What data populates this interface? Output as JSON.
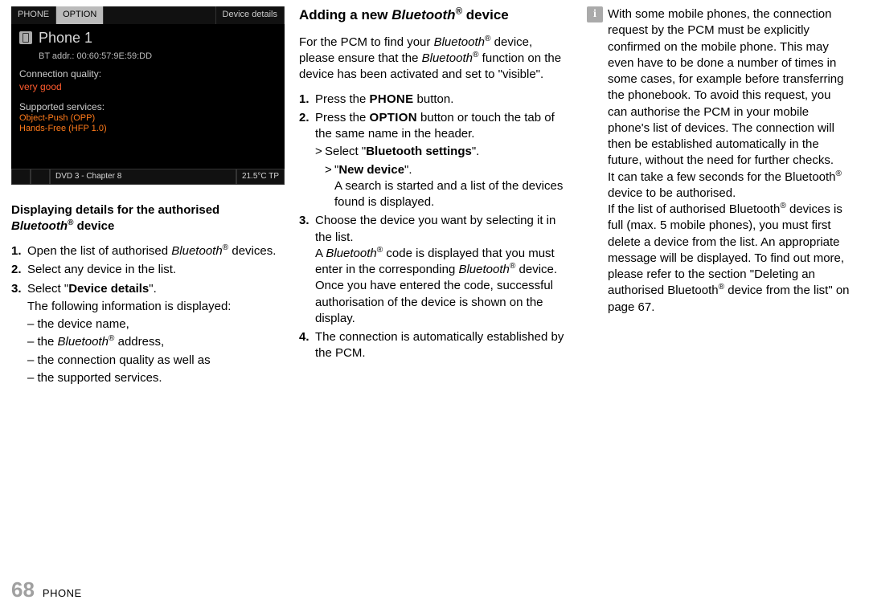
{
  "pcm": {
    "tabs": [
      "PHONE",
      "OPTION",
      "Device details"
    ],
    "phone_title": "Phone 1",
    "bt_addr_label": "BT addr.: 00:60:57:9E:59:DD",
    "quality_label": "Connection quality:",
    "quality_value": "very good",
    "services_label": "Supported services:",
    "services_value_1": "Object-Push (OPP)",
    "services_value_2": "Hands-Free (HFP 1.0)",
    "footer_media": "DVD 3 - Chapter 8",
    "footer_temp": "21.5°C  TP"
  },
  "col1": {
    "heading_pre": "Displaying details for the authorised ",
    "heading_bt": "Bluetooth",
    "heading_post": " device",
    "step1_a": "Open the list of authorised ",
    "step1_b": " devices.",
    "step2": "Select any device in the list.",
    "step3_a": "Select \"",
    "step3_link": "Device details",
    "step3_b": "\".",
    "step3_follow": "The following information is displayed:",
    "step3_d1": "– the device name,",
    "step3_d2_a": "– the ",
    "step3_d2_b": " address,",
    "step3_d3": "– the connection quality as well as",
    "step3_d4": "– the supported services."
  },
  "col2": {
    "heading_a": "Adding a new ",
    "heading_bt": "Bluetooth",
    "heading_b": " device",
    "intro_a": "For the PCM to find your ",
    "intro_b": " device, please ensure that the ",
    "intro_c": " function on the device has been activated and set to \"visible\".",
    "s1_a": "Press the ",
    "s1_btn": "PHONE",
    "s1_b": " button.",
    "s2_a": "Press the ",
    "s2_btn": "OPTION",
    "s2_b": " button or touch the tab of the same name in the header.",
    "s2_sub1_a": "Select \"",
    "s2_sub1_link": "Bluetooth settings",
    "s2_sub1_b": "\".",
    "s2_sub2_a": "\"",
    "s2_sub2_link": "New device",
    "s2_sub2_b": "\".",
    "s2_sub2_follow": "A search is started and a list of the devices found is displayed.",
    "s3_a": "Choose the device you want by selecting it in the list.",
    "s3_b_a": "A ",
    "s3_b_b": " code is displayed that you must enter in the corresponding ",
    "s3_b_c": " device. Once you have entered the code, successful authorisation of the device is shown on the display.",
    "s4": "The connection is automatically established by the PCM."
  },
  "col3": {
    "info_icon": "i",
    "p1": "With some mobile phones, the connection request by the PCM must be explicitly confirmed on the mobile phone. This may even have to be done a number of times in some cases, for example before transferring the phonebook. To avoid this request, you can authorise the PCM in your mobile phone's list of devices. The connection will then be established automatically in the future, without the need for further checks.",
    "p2_a": "It can take a few seconds for the ",
    "p2_b": " device to be authorised.",
    "p3_a": "If the list of authorised ",
    "p3_b": " devices is full (max. 5 mobile phones), you must first delete a device from the list. An appropriate message will be displayed. To find out more, please refer to the section \"Deleting an authorised Bluetooth",
    "p3_c": " device from the list\" on page 67."
  },
  "footer": {
    "page": "68",
    "section": "PHONE"
  }
}
